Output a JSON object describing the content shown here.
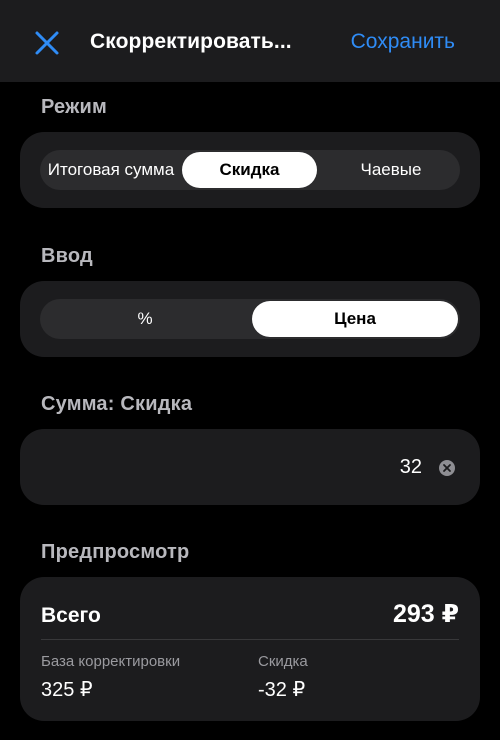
{
  "nav": {
    "title": "Скорректировать...",
    "save_label": "Сохранить",
    "close_icon": "close-icon",
    "accent_color": "#2f8cf6"
  },
  "mode": {
    "section_label": "Режим",
    "options": [
      "Итоговая сумма",
      "Скидка",
      "Чаевые"
    ],
    "selected": "Скидка"
  },
  "input": {
    "section_label": "Ввод",
    "options": [
      "%",
      "Цена"
    ],
    "selected": "Цена"
  },
  "amount": {
    "section_label": "Сумма: Скидка",
    "value": "32",
    "clear_icon": "clear-icon"
  },
  "preview": {
    "section_label": "Предпросмотр",
    "total_label": "Всего",
    "total_value": "293 ₽",
    "base_label": "База корректировки",
    "base_value": "325 ₽",
    "discount_label": "Скидка",
    "discount_value": "-32 ₽"
  }
}
